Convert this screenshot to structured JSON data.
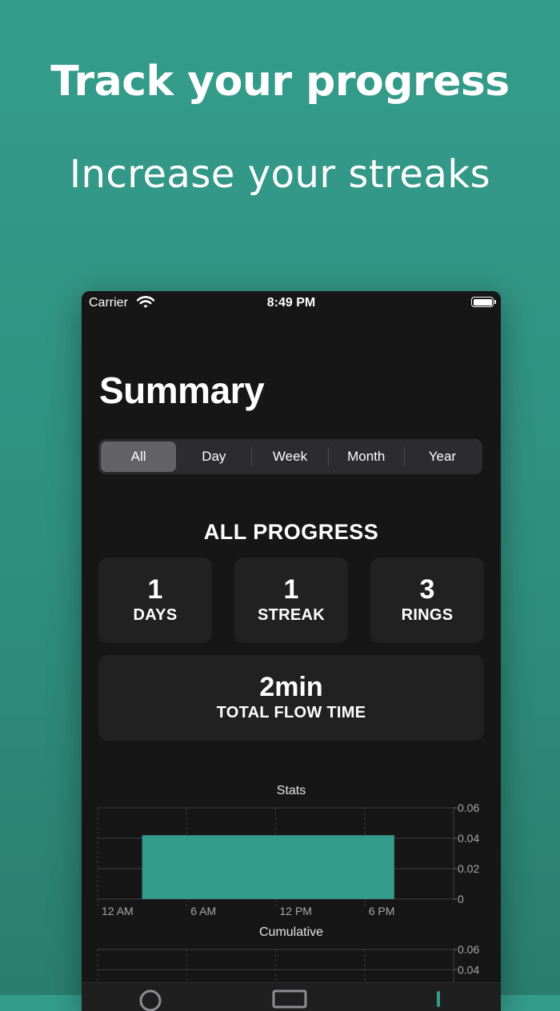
{
  "promo": {
    "headline": "Track your progress",
    "subheadline": "Increase your streaks"
  },
  "status_bar": {
    "carrier": "Carrier",
    "time": "8:49 PM",
    "wifi_icon": "wifi-icon",
    "battery_icon": "battery-icon"
  },
  "screen": {
    "title": "Summary"
  },
  "segments": [
    {
      "label": "All",
      "selected": true
    },
    {
      "label": "Day",
      "selected": false
    },
    {
      "label": "Week",
      "selected": false
    },
    {
      "label": "Month",
      "selected": false
    },
    {
      "label": "Year",
      "selected": false
    }
  ],
  "progress": {
    "title": "ALL PROGRESS",
    "days": {
      "value": "1",
      "label": "DAYS"
    },
    "streak": {
      "value": "1",
      "label": "STREAK"
    },
    "rings": {
      "value": "3",
      "label": "RINGS"
    },
    "flow": {
      "value": "2min",
      "label": "TOTAL FLOW TIME"
    }
  },
  "chart_data": [
    {
      "type": "bar",
      "title": "Stats",
      "x_tick_labels": [
        "12 AM",
        "6 AM",
        "12 PM",
        "6 PM"
      ],
      "y_tick_labels": [
        "0.06",
        "0.04",
        "0.02",
        "0"
      ],
      "ylim": [
        0,
        0.06
      ],
      "bars": [
        {
          "x_start": "3 AM",
          "x_end": "8 PM",
          "value": 0.042
        }
      ],
      "grid": true,
      "bar_color": "#349c8c"
    },
    {
      "type": "bar",
      "title": "Cumulative",
      "y_tick_labels": [
        "0.06",
        "0.04"
      ],
      "ylim": [
        0,
        0.06
      ],
      "grid": true
    }
  ],
  "colors": {
    "accent": "#349c8c",
    "background": "#161616",
    "card": "#212121"
  }
}
